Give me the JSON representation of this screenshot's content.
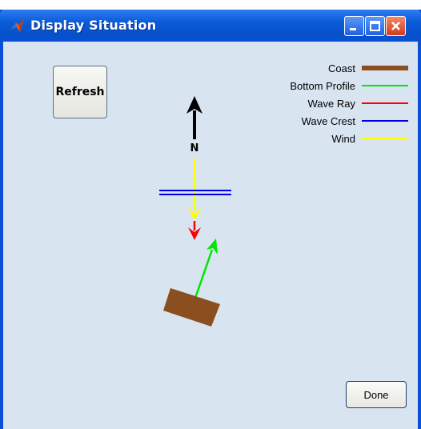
{
  "window": {
    "title": "Display Situation",
    "app_icon": "matlab-icon"
  },
  "titlebar_buttons": {
    "minimize": "minimize-icon",
    "maximize": "maximize-icon",
    "close": "close-icon"
  },
  "buttons": {
    "refresh_label": "Refresh",
    "done_label": "Done"
  },
  "compass": {
    "north_label": "N"
  },
  "legend": [
    {
      "label": "Coast",
      "color": "#8b4f1f"
    },
    {
      "label": "Bottom Profile",
      "color": "#00e800"
    },
    {
      "label": "Wave Ray",
      "color": "#ff0000"
    },
    {
      "label": "Wave Crest",
      "color": "#0000e6"
    },
    {
      "label": "Wind",
      "color": "#ffff00"
    }
  ],
  "colors": {
    "titlebar": "#0a5bd8",
    "client_background": "#d8e4f0",
    "north_arrow": "#000000"
  }
}
